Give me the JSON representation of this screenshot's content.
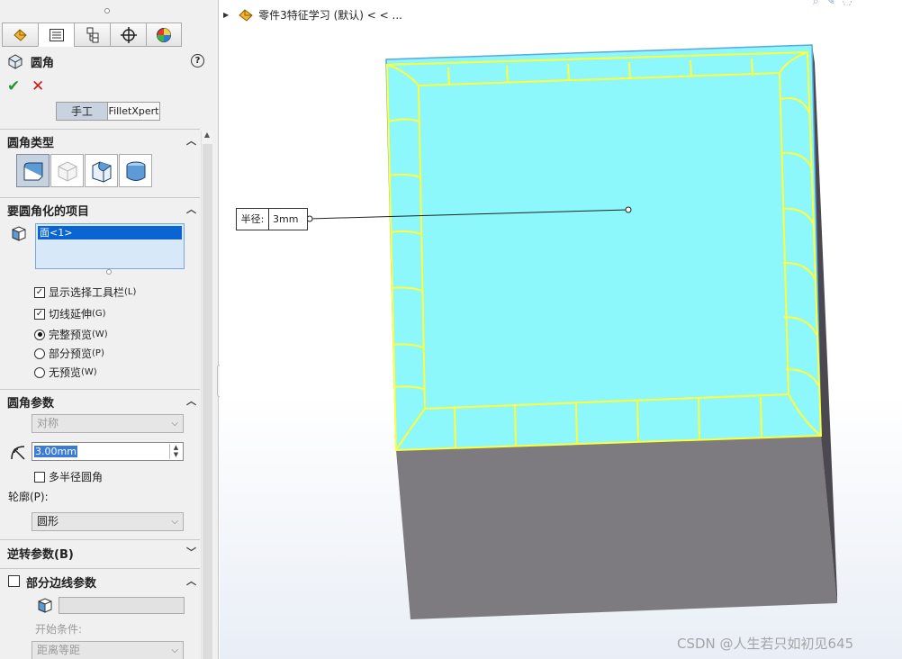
{
  "property_manager": {
    "tabs": [
      "feature-manager",
      "property-manager",
      "configuration-manager",
      "dimxpert-manager",
      "display-manager"
    ],
    "title": "圆角",
    "help": "?",
    "mode_manual": "手工",
    "mode_expert": "FilletXpert"
  },
  "fillet_type": {
    "header": "圆角类型",
    "options": [
      "constant-size",
      "variable-size",
      "face-fillet",
      "full-round"
    ]
  },
  "items": {
    "header": "要圆角化的项目",
    "selection": "面<1>",
    "show_toolbar": {
      "label": "显示选择工具栏",
      "shortcut": "(L)",
      "checked": true
    },
    "tangent": {
      "label": "切线延伸",
      "shortcut": "(G)",
      "checked": true
    },
    "preview_full": {
      "label": "完整预览",
      "shortcut": "(W)",
      "selected": true
    },
    "preview_partial": {
      "label": "部分预览",
      "shortcut": "(P)",
      "selected": false
    },
    "preview_none": {
      "label": "无预览",
      "shortcut": "(W)",
      "selected": false
    }
  },
  "params": {
    "header": "圆角参数",
    "method": "对称",
    "radius": "3.00mm",
    "multi_radius": "多半径圆角",
    "profile_label": "轮廓(P):",
    "profile": "圆形"
  },
  "setback": {
    "header": "逆转参数(B)"
  },
  "partial_edge": {
    "header": "部分边线参数",
    "start_condition": "开始条件:",
    "offset": "距离等距"
  },
  "viewport": {
    "tree_label": "零件3特征学习  (默认) < < ...",
    "dim_label": "半径:",
    "dim_value": "3mm",
    "colors": {
      "top_face": "#8cf8fb",
      "side_face": "#7d7b80",
      "highlight": "#ffff3a"
    }
  },
  "watermark": "CSDN @人生若只如初见645"
}
